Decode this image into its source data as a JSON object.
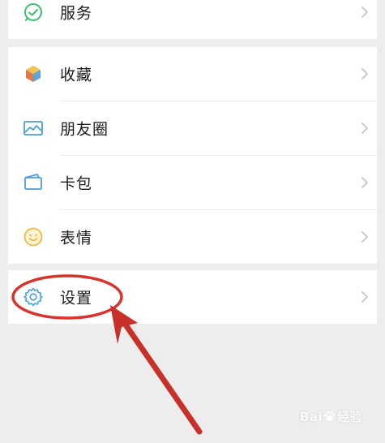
{
  "menu": {
    "rows": [
      {
        "label": "服务",
        "icon": "service-icon"
      },
      {
        "label": "收藏",
        "icon": "favorites-icon"
      },
      {
        "label": "朋友圈",
        "icon": "moments-icon"
      },
      {
        "label": "卡包",
        "icon": "card-wallet-icon"
      },
      {
        "label": "表情",
        "icon": "sticker-icon"
      },
      {
        "label": "设置",
        "icon": "settings-icon"
      }
    ],
    "chevron_icon": "chevron-right-icon"
  },
  "annotation": {
    "color": "#d9332b",
    "shapes": [
      "highlight-ellipse",
      "pointer-arrow"
    ]
  },
  "watermark": {
    "text_left": "Bai",
    "text_right": "经验",
    "icon": "baidu-paw-icon"
  },
  "colors": {
    "background": "#ededed",
    "row_background": "#ffffff",
    "label": "#1b1b1b",
    "service_icon": "#3cbf6f",
    "favorites_icon_a": "#f3c24f",
    "favorites_icon_b": "#5aa7e0",
    "moments_icon": "#4a9fd8",
    "card_icon": "#4a9fd8",
    "sticker_icon": "#f0b940",
    "settings_icon": "#4a9fd8"
  }
}
